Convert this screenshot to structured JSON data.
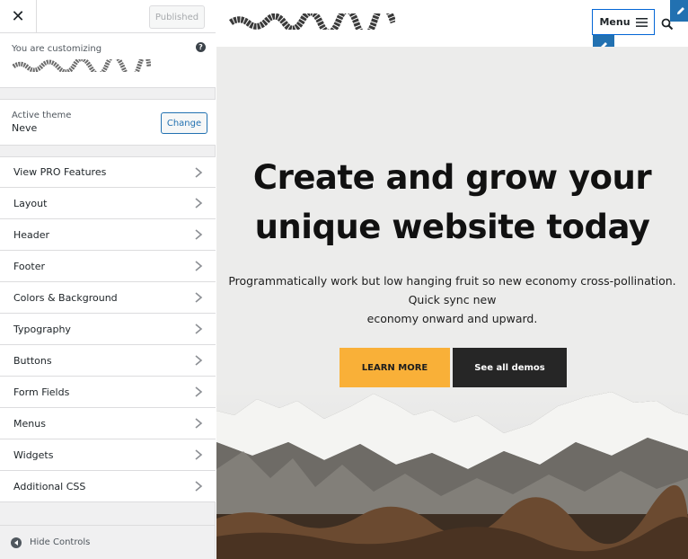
{
  "customizer": {
    "close_label": "✕",
    "published_label": "Published",
    "customizing_label": "You are customizing",
    "help_icon": "?",
    "active_theme_label": "Active theme",
    "active_theme_name": "Neve",
    "change_label": "Change",
    "menu_items": [
      {
        "label": "View PRO Features"
      },
      {
        "label": "Layout"
      },
      {
        "label": "Header"
      },
      {
        "label": "Footer"
      },
      {
        "label": "Colors & Background"
      },
      {
        "label": "Typography"
      },
      {
        "label": "Buttons"
      },
      {
        "label": "Form Fields"
      },
      {
        "label": "Menus"
      },
      {
        "label": "Widgets"
      },
      {
        "label": "Additional CSS"
      }
    ],
    "hide_controls_label": "Hide Controls"
  },
  "preview": {
    "menu_label": "Menu",
    "hero_title": "Create and grow your unique website today",
    "hero_text_line1": "Programmatically work but low hanging fruit so new economy cross-pollination. Quick sync new",
    "hero_text_line2": "economy onward and upward.",
    "primary_button": "LEARN MORE",
    "secondary_button": "See all demos"
  },
  "colors": {
    "accent": "#2271b1",
    "primary_button_bg": "#f9b038",
    "secondary_button_bg": "#262626",
    "menu_border": "#0366d6"
  }
}
